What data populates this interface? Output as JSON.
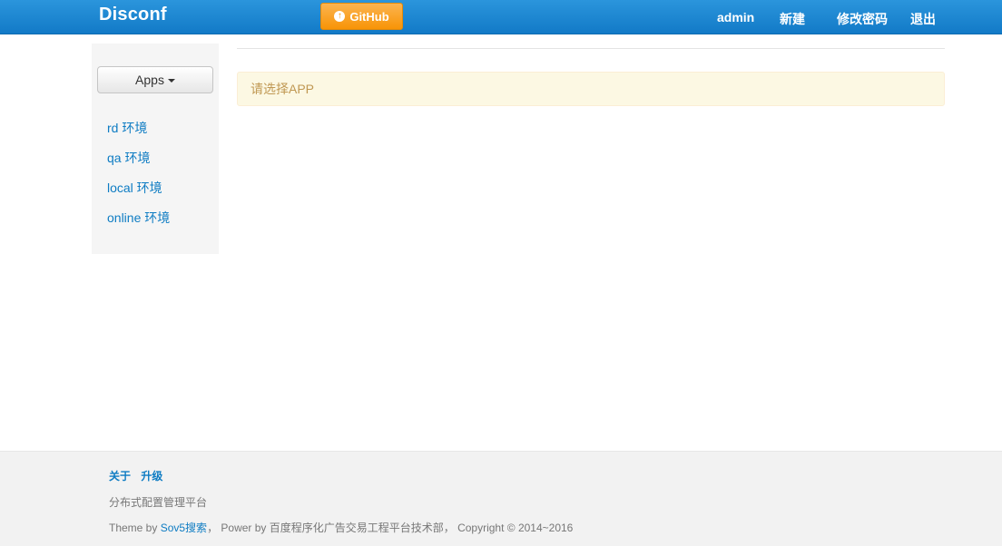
{
  "navbar": {
    "brand": "Disconf",
    "github_label": "GitHub",
    "github_icon": "up-arrow-circle-icon",
    "links": [
      {
        "label": "admin"
      },
      {
        "label": "新建"
      },
      {
        "label": "修改密码"
      },
      {
        "label": "退出"
      }
    ]
  },
  "sidebar": {
    "apps_button": "Apps",
    "envs": [
      {
        "label": "rd 环境"
      },
      {
        "label": "qa 环境"
      },
      {
        "label": "local 环境"
      },
      {
        "label": "online 环境"
      }
    ]
  },
  "main": {
    "alert": "请选择APP"
  },
  "footer": {
    "links": [
      {
        "label": "关于"
      },
      {
        "label": "升级"
      }
    ],
    "tagline": "分布式配置管理平台",
    "credits_prefix": "Theme by ",
    "theme_link": "Sov5搜索",
    "credits_suffix": "，   Power by 百度程序化广告交易工程平台技术部，  Copyright © 2014~2016"
  },
  "colors": {
    "navbar": "#1a86d0",
    "github_button": "#f89406",
    "link": "#0e7cc3",
    "alert_bg": "#fcf8e3",
    "alert_text": "#c09853"
  }
}
